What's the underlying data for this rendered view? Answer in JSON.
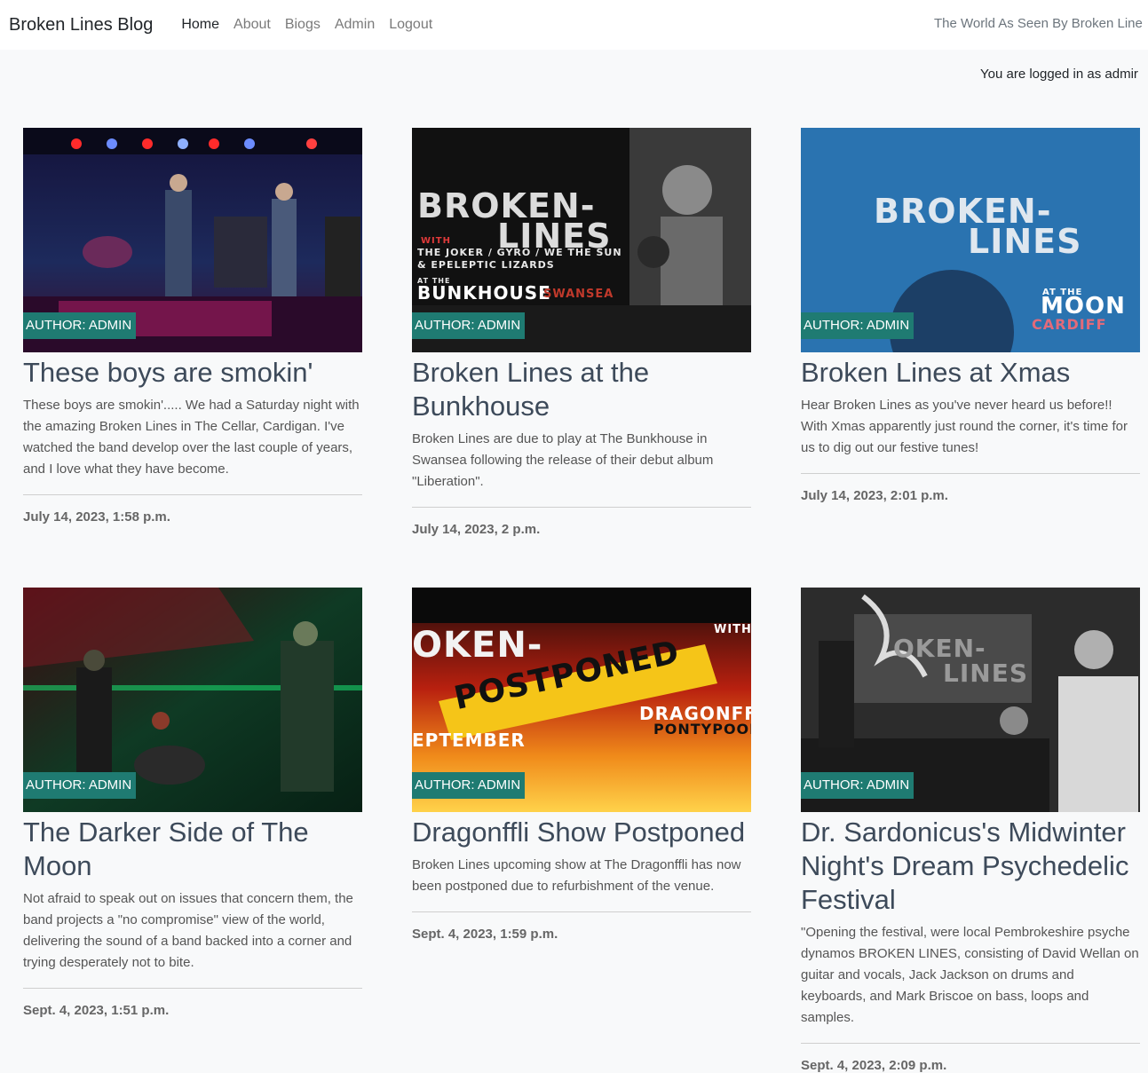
{
  "navbar": {
    "brand": "Broken Lines Blog",
    "links": [
      {
        "label": "Home",
        "active": true
      },
      {
        "label": "About",
        "active": false
      },
      {
        "label": "Biogs",
        "active": false
      },
      {
        "label": "Admin",
        "active": false
      },
      {
        "label": "Logout",
        "active": false
      }
    ],
    "tagline": "The World As Seen By Broken Line"
  },
  "status": {
    "logged_in": "You are logged in as admir"
  },
  "posts": [
    {
      "image_text": [],
      "author": "AUTHOR: ADMIN",
      "title": "These boys are smokin'",
      "excerpt": "These boys are smokin'..... We had a Saturday night with the amazing Broken Lines in The Cellar, Cardigan. I've watched the band develop over the last couple of years, and I love what they have become.",
      "date": "July 14, 2023, 1:58 p.m."
    },
    {
      "image_text": [
        "BROKEN-",
        "LINES",
        "WITH",
        "THE JOKER / GYRO / WE THE SUN",
        "& EPELEPTIC LIZARDS",
        "AT THE",
        "BUNKHOUSE",
        "SWANSEA"
      ],
      "author": "AUTHOR: ADMIN",
      "title": "Broken Lines at the Bunkhouse",
      "excerpt": "Broken Lines are due to play at The Bunkhouse in Swansea following the release of their debut album \"Liberation\".",
      "date": "July 14, 2023, 2 p.m."
    },
    {
      "image_text": [
        "BROKEN-",
        "LINES",
        "AT THE",
        "MOON",
        "CARDIFF"
      ],
      "author": "AUTHOR: ADMIN",
      "title": "Broken Lines at Xmas",
      "excerpt": "Hear Broken Lines as you've never heard us before!! With Xmas apparently just round the corner, it's time for us to dig out our festive tunes!",
      "date": "July 14, 2023, 2:01 p.m."
    },
    {
      "image_text": [],
      "author": "AUTHOR: ADMIN",
      "title": "The Darker Side of The Moon",
      "excerpt": "Not afraid to speak out on issues that concern them, the band projects a \"no compromise\" view of the world, delivering the sound of a band backed into a corner and trying desperately not to bite.",
      "date": "Sept. 4, 2023, 1:51 p.m."
    },
    {
      "image_text": [
        "OKEN-",
        "POSTPONED",
        "WITH",
        "DRAGONFFLI",
        "PONTYPOOL",
        "EPTEMBER"
      ],
      "author": "AUTHOR: ADMIN",
      "title": "Dragonffli Show Postponed",
      "excerpt": "Broken Lines upcoming show at The Dragonffli has now been postponed due to refurbishment of the venue.",
      "date": "Sept. 4, 2023, 1:59 p.m."
    },
    {
      "image_text": [
        "OKEN-",
        "LINES"
      ],
      "author": "AUTHOR: ADMIN",
      "title": "Dr. Sardonicus's Midwinter Night's Dream Psychedelic Festival",
      "excerpt": "\"Opening the festival, were local Pembrokeshire psyche dynamos BROKEN LINES, consisting of David Wellan on guitar and vocals, Jack Jackson on drums and keyboards, and Mark Briscoe on bass, loops and samples.",
      "date": "Sept. 4, 2023, 2:09 p.m."
    }
  ],
  "colors": {
    "accent_badge": "#1f7b72",
    "page_bg": "#f8f9fa",
    "title": "#3d4a5a"
  }
}
